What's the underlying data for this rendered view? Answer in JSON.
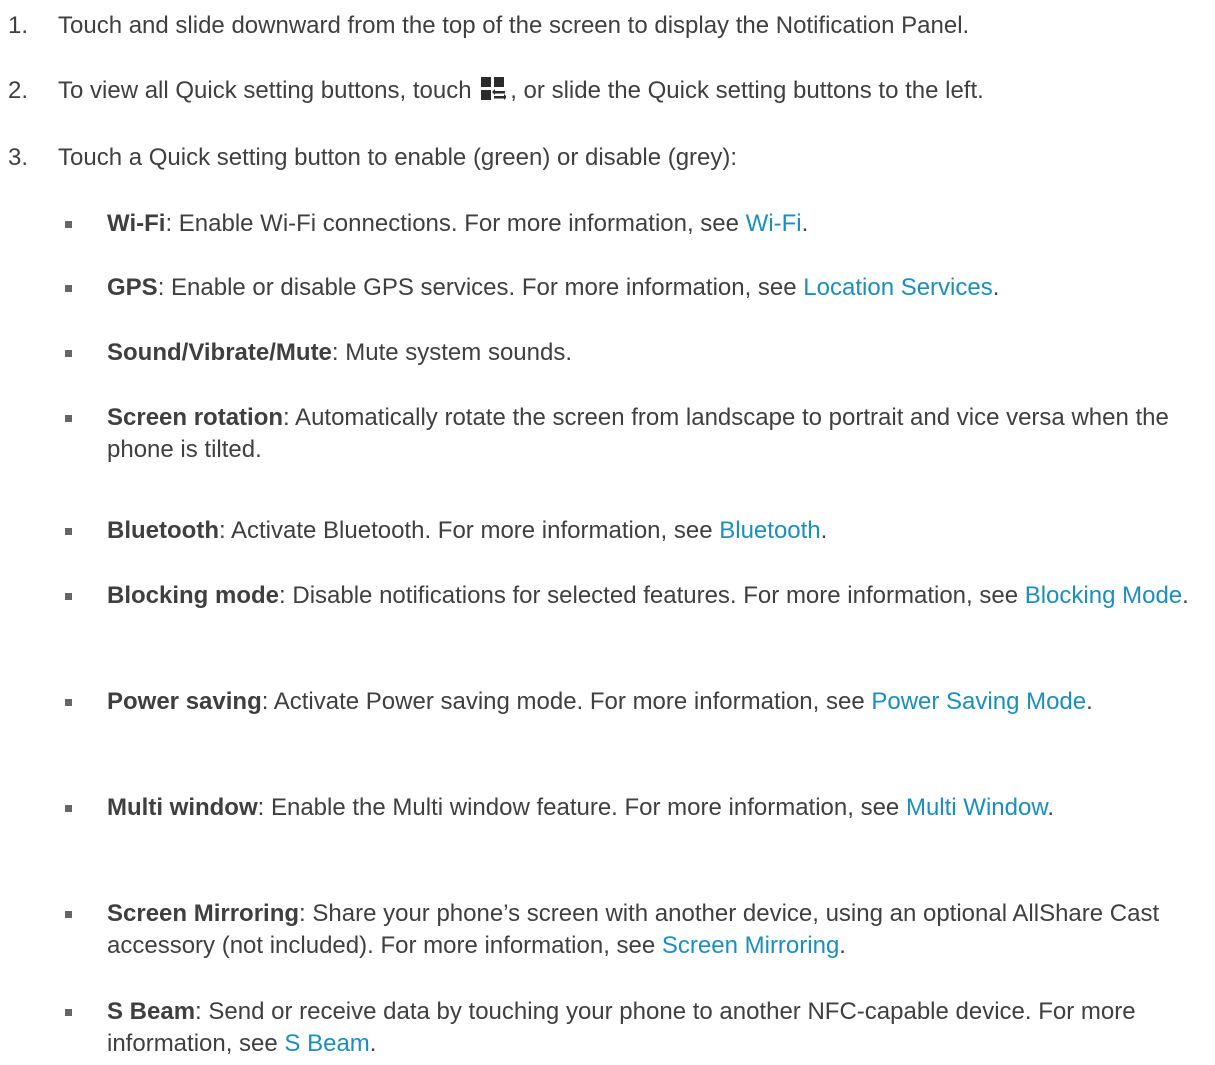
{
  "steps": [
    {
      "num": "1.",
      "text": "Touch and slide downward from the top of the screen to display the Notification Panel."
    },
    {
      "num": "2.",
      "text_before": "To view all Quick setting buttons, touch",
      "text_after": ", or slide the Quick setting buttons to the left."
    },
    {
      "num": "3.",
      "text": "Touch a Quick setting button to enable (green) or disable (grey):"
    }
  ],
  "bullets": [
    {
      "term": "Wi-Fi",
      "text": ": Enable Wi-Fi connections. For more information, see ",
      "link": "Wi-Fi",
      "end": "."
    },
    {
      "term": "GPS",
      "text": ": Enable or disable GPS services. For more information, see ",
      "link": "Location Services",
      "end": "."
    },
    {
      "term": "Sound/Vibrate/Mute",
      "text": ": Mute system sounds.",
      "link": "",
      "end": ""
    },
    {
      "term": "Screen rotation",
      "text": ": Automatically rotate the screen from landscape to portrait and vice versa when the phone is tilted.",
      "link": "",
      "end": ""
    },
    {
      "term": "Bluetooth",
      "text": ": Activate Bluetooth. For more information, see ",
      "link": "Bluetooth",
      "end": "."
    },
    {
      "term": "Blocking mode",
      "text": ": Disable notifications for selected features. For more information, see ",
      "link": "Blocking Mode",
      "end": "."
    },
    {
      "term": "Power saving",
      "text": ": Activate Power saving mode. For more information, see ",
      "link": "Power Saving Mode",
      "end": "."
    },
    {
      "term": "Multi window",
      "text": ": Enable the Multi window feature. For more information, see ",
      "link": "Multi Window",
      "end": "."
    },
    {
      "term": "Screen Mirroring",
      "text": ": Share your phone’s screen with another device, using an optional AllShare Cast accessory (not included). For more information, see ",
      "link": "Screen Mirroring",
      "end": "."
    },
    {
      "term": "S Beam",
      "text": ": Send or receive data by touching your phone to another NFC-capable device. For more information, see ",
      "link": "S Beam",
      "end": "."
    }
  ],
  "icons": {
    "quick_settings": "quick-settings-grid-icon"
  },
  "colors": {
    "text": "#3f3f3f",
    "link": "#1a8fbf",
    "bullet": "#666666"
  }
}
